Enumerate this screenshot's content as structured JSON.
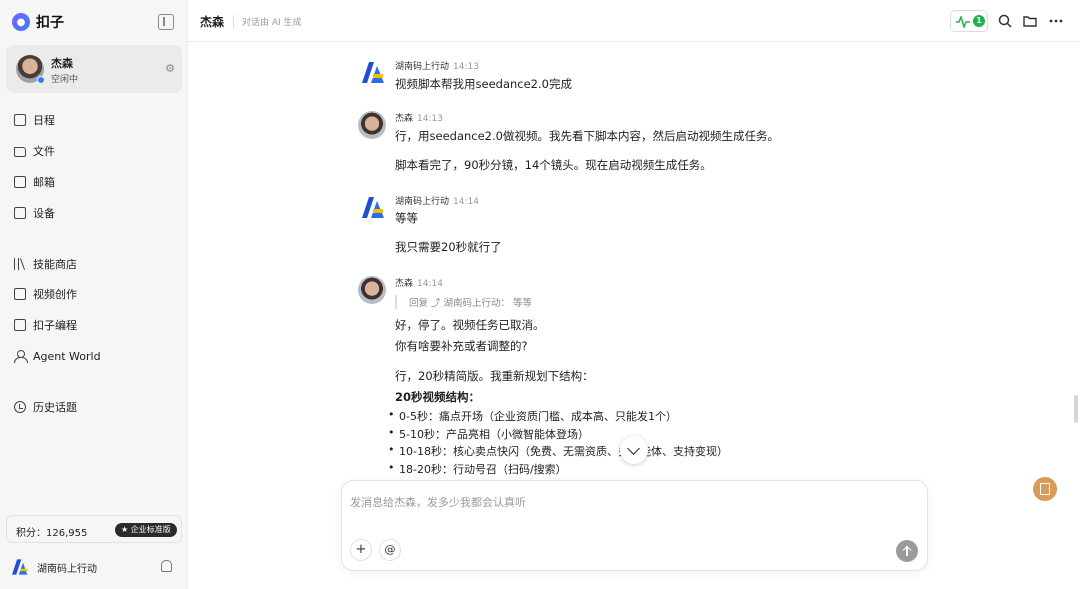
{
  "app": {
    "name": "扣子"
  },
  "profile": {
    "name": "杰森",
    "status": "空闲中"
  },
  "nav": [
    {
      "label": "日程",
      "icon": "calendar-icon"
    },
    {
      "label": "文件",
      "icon": "folder-icon"
    },
    {
      "label": "邮箱",
      "icon": "mail-icon"
    },
    {
      "label": "设备",
      "icon": "device-icon"
    },
    {
      "label": "技能商店",
      "icon": "books-icon"
    },
    {
      "label": "视频创作",
      "icon": "video-icon"
    },
    {
      "label": "扣子编程",
      "icon": "code-icon"
    },
    {
      "label": "Agent World",
      "icon": "person-icon"
    },
    {
      "label": "历史话题",
      "icon": "history-icon"
    }
  ],
  "points": {
    "text": "积分：126,955",
    "badge": "企业标准版"
  },
  "workspace": {
    "name": "湖南码上行动"
  },
  "header": {
    "title": "杰森",
    "subtitle": "对话由 AI 生成",
    "activity_count": "1"
  },
  "messages": [
    {
      "sender": "湖南码上行动",
      "time": "14:13",
      "lines": [
        "视频脚本帮我用seedance2.0完成"
      ]
    },
    {
      "sender": "杰森",
      "time": "14:13",
      "lines": [
        "行，用seedance2.0做视频。我先看下脚本内容，然后启动视频生成任务。",
        "脚本看完了，90秒分镜，14个镜头。现在启动视频生成任务。"
      ]
    },
    {
      "sender": "湖南码上行动",
      "time": "14:14",
      "lines": [
        "等等",
        "我只需要20秒就行了"
      ]
    },
    {
      "sender": "杰森",
      "time": "14:14",
      "quote": "回复 ⤴ 湖南码上行动：  等等",
      "lines": [
        "好，停了。视频任务已取消。",
        "你有啥要补充或者调整的?",
        "行，20秒精简版。我重新规划下结构：",
        "20秒视频结构："
      ],
      "bullets": [
        "0-5秒：痛点开场（企业资质门槛、成本高、只能发1个）",
        "5-10秒：产品亮相（小微智能体登场）",
        "10-18秒：核心卖点快闪（免费、无需资质、多智能体、支持变现）",
        "18-20秒：行动号召（扫码/搜索）"
      ]
    }
  ],
  "composer": {
    "placeholder": "发消息给杰森，发多少我都会认真听",
    "plus_label": "+",
    "at_label": "@"
  }
}
